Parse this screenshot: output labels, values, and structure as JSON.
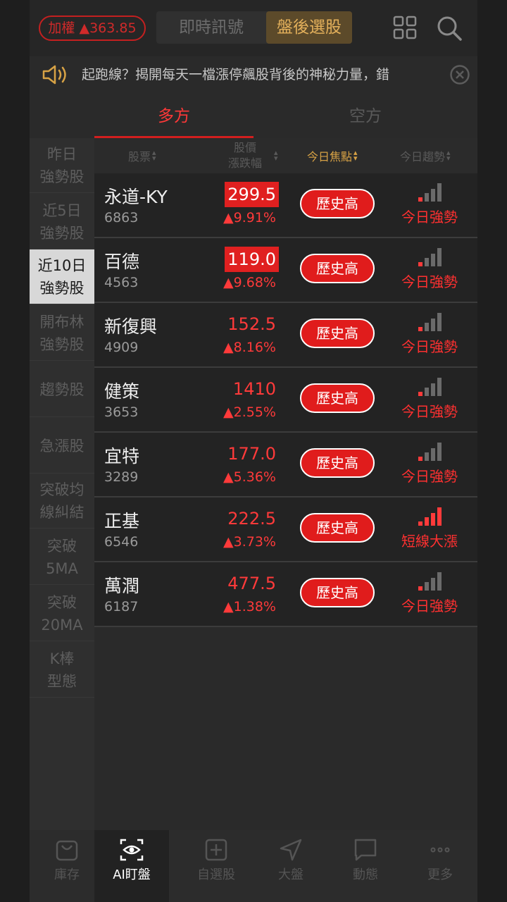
{
  "header": {
    "index_label": "加權 ▲363.85",
    "tabs": [
      {
        "label": "即時訊號",
        "active": false
      },
      {
        "label": "盤後選股",
        "active": true
      }
    ],
    "grid_icon": "grid-icon",
    "search_icon": "search-icon"
  },
  "marquee": {
    "text": "起跑線？揭開每天一檔漲停飆股背後的神秘力量，錯",
    "speaker_icon": "speaker-icon",
    "close_icon": "close-circle-icon"
  },
  "direction_tabs": [
    {
      "label": "多方",
      "active": true
    },
    {
      "label": "空方",
      "active": false
    }
  ],
  "categories": [
    {
      "line1": "昨日",
      "line2": "強勢股",
      "active": false
    },
    {
      "line1": "近5日",
      "line2": "強勢股",
      "active": false
    },
    {
      "line1": "近10日",
      "line2": "強勢股",
      "active": true
    },
    {
      "line1": "開布林",
      "line2": "強勢股",
      "active": false
    },
    {
      "line1": "趨勢股",
      "line2": "",
      "active": false
    },
    {
      "line1": "急漲股",
      "line2": "",
      "active": false
    },
    {
      "line1": "突破均",
      "line2": "線糾結",
      "active": false
    },
    {
      "line1": "突破",
      "line2": "5MA",
      "active": false
    },
    {
      "line1": "突破",
      "line2": "20MA",
      "active": false
    },
    {
      "line1": "K棒",
      "line2": "型態",
      "active": false
    }
  ],
  "table": {
    "headers": {
      "stock": "股票",
      "price_line1": "股價",
      "price_line2": "漲跌幅",
      "focus": "今日焦點",
      "trend": "今日趨勢"
    },
    "rows": [
      {
        "name": "永道-KY",
        "code": "6863",
        "price": "299.5",
        "price_highlight": true,
        "change": "▲9.91%",
        "focus": "歷史高",
        "trend": "今日強勢",
        "trend_bars": 1
      },
      {
        "name": "百德",
        "code": "4563",
        "price": "119.0",
        "price_highlight": true,
        "change": "▲9.68%",
        "focus": "歷史高",
        "trend": "今日強勢",
        "trend_bars": 1
      },
      {
        "name": "新復興",
        "code": "4909",
        "price": "152.5",
        "price_highlight": false,
        "change": "▲8.16%",
        "focus": "歷史高",
        "trend": "今日強勢",
        "trend_bars": 1
      },
      {
        "name": "健策",
        "code": "3653",
        "price": "1410",
        "price_highlight": false,
        "change": "▲2.55%",
        "focus": "歷史高",
        "trend": "今日強勢",
        "trend_bars": 1
      },
      {
        "name": "宜特",
        "code": "3289",
        "price": "177.0",
        "price_highlight": false,
        "change": "▲5.36%",
        "focus": "歷史高",
        "trend": "今日強勢",
        "trend_bars": 1
      },
      {
        "name": "正基",
        "code": "6546",
        "price": "222.5",
        "price_highlight": false,
        "change": "▲3.73%",
        "focus": "歷史高",
        "trend": "短線大漲",
        "trend_bars": 4
      },
      {
        "name": "萬潤",
        "code": "6187",
        "price": "477.5",
        "price_highlight": false,
        "change": "▲1.38%",
        "focus": "歷史高",
        "trend": "今日強勢",
        "trend_bars": 1
      }
    ]
  },
  "bottom_nav": [
    {
      "label": "庫存",
      "icon": "bag-icon",
      "active": false
    },
    {
      "label": "AI盯盤",
      "icon": "eye-scan-icon",
      "active": true
    },
    {
      "label": "自選股",
      "icon": "plus-square-icon",
      "active": false
    },
    {
      "label": "大盤",
      "icon": "navigation-arrow-icon",
      "active": false
    },
    {
      "label": "動態",
      "icon": "chat-bubble-icon",
      "active": false
    },
    {
      "label": "更多",
      "icon": "more-dots-icon",
      "active": false
    }
  ],
  "colors": {
    "up_red": "#ff3a3a",
    "accent_gold": "#e3b05b",
    "background": "#2a2a2a"
  }
}
